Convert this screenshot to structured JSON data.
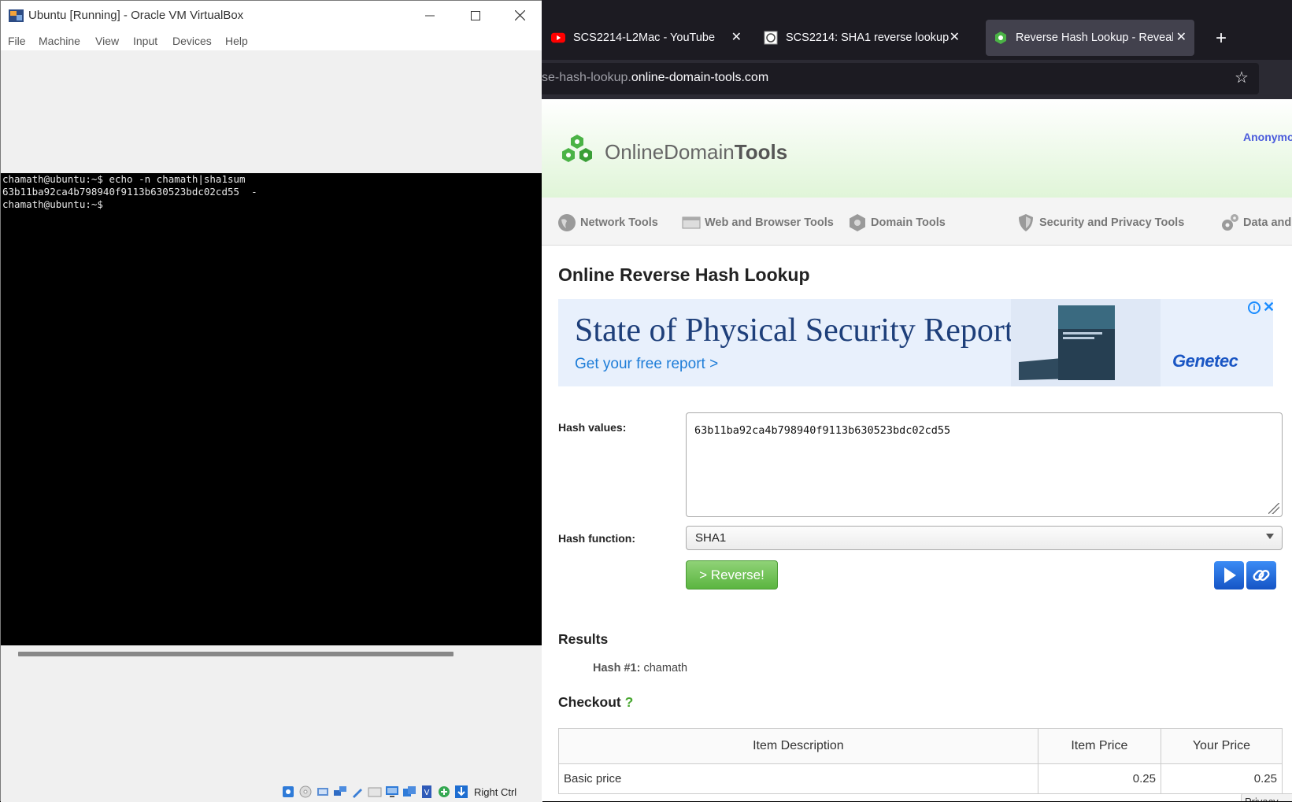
{
  "vbox": {
    "title": "Ubuntu [Running] - Oracle VM VirtualBox",
    "menu": [
      "File",
      "Machine",
      "View",
      "Input",
      "Devices",
      "Help"
    ],
    "terminal_lines": [
      "chamath@ubuntu:~$ echo -n chamath|sha1sum",
      "63b11ba92ca4b798940f9113b630523bdc02cd55  -",
      "chamath@ubuntu:~$"
    ],
    "host_key": "Right Ctrl"
  },
  "browser": {
    "tabs": [
      {
        "label": "SCS2214-L2Mac - YouTube",
        "icon": "youtube-icon"
      },
      {
        "label": "SCS2214: SHA1 reverse lookup",
        "icon": "ucsc-icon"
      },
      {
        "label": "Reverse Hash Lookup - Reveal p",
        "icon": "odt-hexagon-icon"
      }
    ],
    "url_dim": "se-hash-lookup.",
    "url_main": "online-domain-tools.com"
  },
  "site": {
    "logo_light": "Online",
    "logo_mid": "Domain",
    "logo_bold": "Tools",
    "account_link": "Anonymo",
    "nav": [
      "Network Tools",
      "Web and Browser Tools",
      "Domain Tools",
      "Security and Privacy Tools",
      "Data and"
    ],
    "page_title": "Online Reverse Hash Lookup",
    "ad": {
      "headline": "State of Physical Security Report",
      "cta": "Get your free report >",
      "brand": "Genetec"
    },
    "form": {
      "hash_values_label": "Hash values:",
      "hash_values": "63b11ba92ca4b798940f9113b630523bdc02cd55",
      "hash_function_label": "Hash function:",
      "hash_function": "SHA1",
      "reverse_button": "> Reverse!"
    },
    "results": {
      "heading": "Results",
      "label": "Hash #1:",
      "value": "chamath"
    },
    "checkout": {
      "heading": "Checkout",
      "help": "?",
      "columns": [
        "Item Description",
        "Item Price",
        "Your Price"
      ],
      "rows": [
        {
          "description": "Basic price",
          "item_price": "0.25",
          "your_price": "0.25"
        }
      ],
      "privacy_badge": "Privacy"
    }
  },
  "colors": {
    "accent_green": "#5bb540",
    "link_blue": "#4a5bdc",
    "browser_chrome": "#1c1b22"
  }
}
